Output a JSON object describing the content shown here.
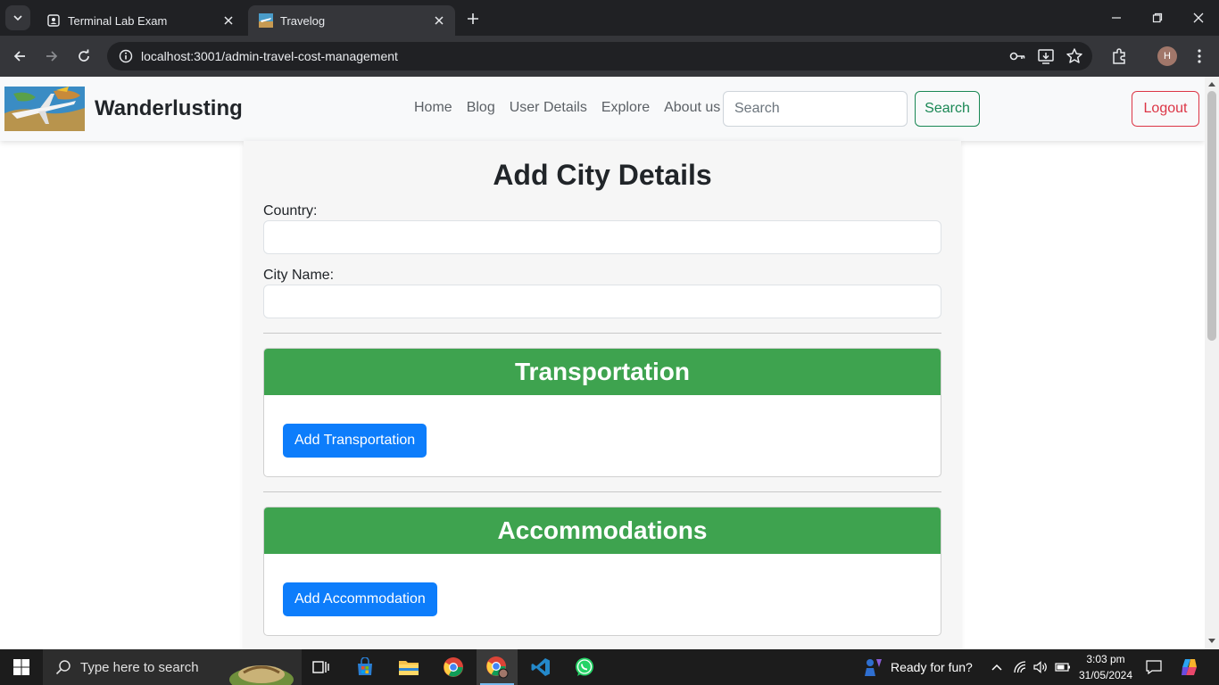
{
  "browser": {
    "tabs": [
      {
        "title": "Terminal Lab Exam",
        "active": false
      },
      {
        "title": "Travelog",
        "active": true
      }
    ],
    "url_host": "localhost",
    "url_rest": ":3001/admin-travel-cost-management",
    "profile_initial": "H"
  },
  "site": {
    "brand": "Wanderlusting",
    "nav_links": [
      "Home",
      "Blog",
      "User Details",
      "Explore",
      "About us"
    ],
    "search_placeholder": "Search",
    "search_button": "Search",
    "logout_button": "Logout"
  },
  "form": {
    "title": "Add City Details",
    "country_label": "Country:",
    "country_value": "",
    "city_label": "City Name:",
    "city_value": "",
    "transportation": {
      "heading": "Transportation",
      "button": "Add Transportation"
    },
    "accommodations": {
      "heading": "Accommodations",
      "button": "Add Accommodation"
    }
  },
  "taskbar": {
    "search_placeholder": "Type here to search",
    "weather_text": "Ready for fun?",
    "time": "3:03 pm",
    "date": "31/05/2024"
  },
  "colors": {
    "section_header": "#3ea34f",
    "primary_button": "#0d7dfb",
    "search_button": "#198754",
    "logout_button": "#dc3545"
  }
}
